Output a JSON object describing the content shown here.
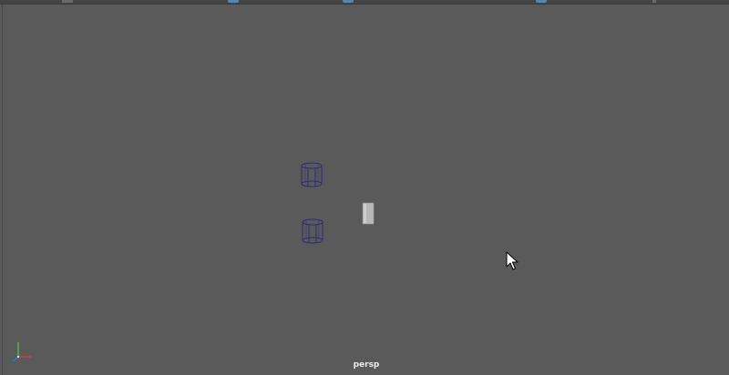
{
  "viewport": {
    "camera_name": "persp",
    "background_color": "#5a5a5a"
  },
  "objects": [
    {
      "name": "cylinder-wireframe-upper",
      "type": "cylinder",
      "display": "wireframe",
      "wire_color": "#2e2a78"
    },
    {
      "name": "cylinder-wireframe-lower",
      "type": "cylinder",
      "display": "wireframe",
      "wire_color": "#2e2a78"
    },
    {
      "name": "box-shaded",
      "type": "cube",
      "display": "shaded",
      "fill_color": "#b9b9b9"
    }
  ],
  "axis_gizmo": {
    "x_color": "#d63a3a",
    "y_color": "#3fbf3f",
    "z_color": "#3a6ad6"
  },
  "cursor": {
    "icon": "arrow-cursor-icon"
  },
  "colors": {
    "toolbar_bg": "#444444",
    "toolbar_accent": "#4f87b8",
    "label_text": "#ececec"
  }
}
